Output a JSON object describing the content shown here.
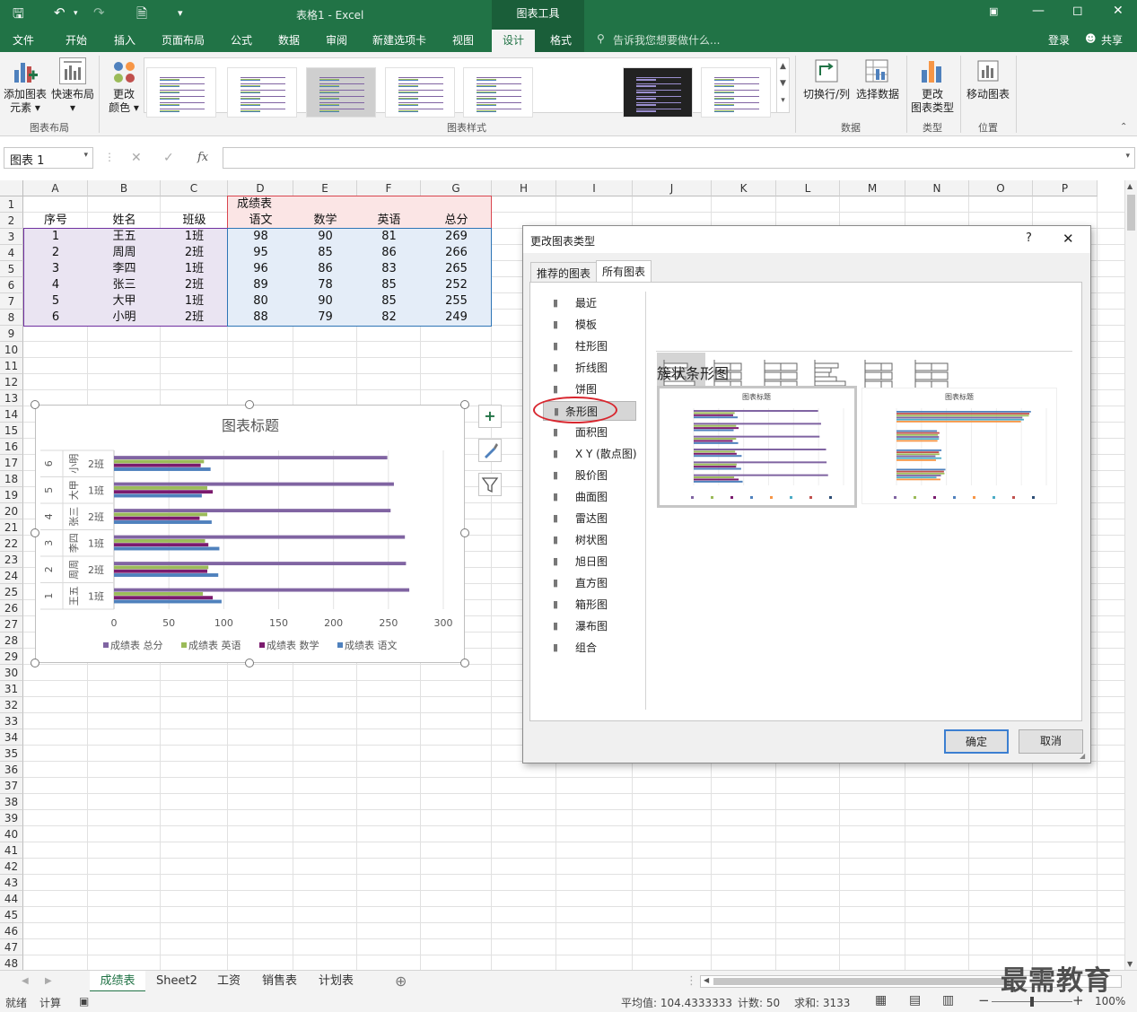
{
  "titlebar": {
    "title": "表格1 - Excel",
    "context_tools": "图表工具"
  },
  "tabs": [
    "文件",
    "开始",
    "插入",
    "页面布局",
    "公式",
    "数据",
    "审阅",
    "新建选项卡",
    "视图",
    "设计",
    "格式"
  ],
  "tell_me": "告诉我您想要做什么...",
  "login": "登录",
  "share": "共享",
  "ribbon": {
    "add_element": [
      "添加图表",
      "元素"
    ],
    "quick_layout": "快速布局",
    "change_color": [
      "更改",
      "颜色"
    ],
    "group_layout": "图表布局",
    "group_styles": "图表样式",
    "switch": "切换行/列",
    "select_data": "选择数据",
    "group_data": "数据",
    "change_type": [
      "更改",
      "图表类型"
    ],
    "group_type": "类型",
    "move_chart": "移动图表",
    "group_position": "位置"
  },
  "namebox": "图表 1",
  "fx": "fx",
  "columns": [
    "A",
    "B",
    "C",
    "D",
    "E",
    "F",
    "G",
    "H",
    "I",
    "J",
    "K",
    "L",
    "M",
    "N",
    "O",
    "P"
  ],
  "rows": [
    "1",
    "2",
    "3",
    "4",
    "5",
    "6",
    "7",
    "8",
    "9",
    "10",
    "11",
    "12",
    "13",
    "14",
    "15",
    "16",
    "17",
    "18",
    "19",
    "20",
    "21",
    "22",
    "23",
    "24",
    "25",
    "26",
    "27",
    "28",
    "29",
    "30",
    "31",
    "32",
    "33",
    "34",
    "35",
    "36",
    "37",
    "38",
    "39",
    "40",
    "41",
    "42",
    "43",
    "44",
    "45",
    "46",
    "47",
    "48"
  ],
  "table": {
    "merged_header": "成绩表",
    "headers": [
      "序号",
      "姓名",
      "班级",
      "语文",
      "数学",
      "英语",
      "总分"
    ],
    "rows": [
      [
        "1",
        "王五",
        "1班",
        "98",
        "90",
        "81",
        "269"
      ],
      [
        "2",
        "周周",
        "2班",
        "95",
        "85",
        "86",
        "266"
      ],
      [
        "3",
        "李四",
        "1班",
        "96",
        "86",
        "83",
        "265"
      ],
      [
        "4",
        "张三",
        "2班",
        "89",
        "78",
        "85",
        "252"
      ],
      [
        "5",
        "大甲",
        "1班",
        "80",
        "90",
        "85",
        "255"
      ],
      [
        "6",
        "小明",
        "2班",
        "88",
        "79",
        "82",
        "249"
      ]
    ]
  },
  "chart_data": {
    "type": "bar",
    "title": "图表标题",
    "categories": [
      {
        "num": "1",
        "name": "王五",
        "cls": "1班"
      },
      {
        "num": "2",
        "name": "周周",
        "cls": "2班"
      },
      {
        "num": "3",
        "name": "李四",
        "cls": "1班"
      },
      {
        "num": "4",
        "name": "张三",
        "cls": "2班"
      },
      {
        "num": "5",
        "name": "大甲",
        "cls": "1班"
      },
      {
        "num": "6",
        "name": "小明",
        "cls": "2班"
      }
    ],
    "series": [
      {
        "name": "成绩表 总分",
        "color": "#8064a2",
        "values": [
          269,
          266,
          265,
          252,
          255,
          249
        ]
      },
      {
        "name": "成绩表 英语",
        "color": "#9bbb59",
        "values": [
          81,
          86,
          83,
          85,
          85,
          82
        ]
      },
      {
        "name": "成绩表 数学",
        "color": "#7b1b6e",
        "values": [
          90,
          85,
          86,
          78,
          90,
          79
        ]
      },
      {
        "name": "成绩表 语文",
        "color": "#4f81bd",
        "values": [
          98,
          95,
          96,
          89,
          80,
          88
        ]
      }
    ],
    "xlim": [
      0,
      300
    ],
    "xticks": [
      "0",
      "50",
      "100",
      "150",
      "200",
      "250",
      "300"
    ],
    "legend": "bottom"
  },
  "dialog": {
    "title": "更改图表类型",
    "help": "?",
    "tab_recommended": "推荐的图表",
    "tab_all": "所有图表",
    "types": [
      {
        "label": "最近",
        "icon": "recent-icon"
      },
      {
        "label": "模板",
        "icon": "folder-icon"
      },
      {
        "label": "柱形图",
        "icon": "column-chart-icon"
      },
      {
        "label": "折线图",
        "icon": "line-chart-icon"
      },
      {
        "label": "饼图",
        "icon": "pie-chart-icon"
      },
      {
        "label": "条形图",
        "icon": "bar-chart-icon"
      },
      {
        "label": "面积图",
        "icon": "area-chart-icon"
      },
      {
        "label": "X Y (散点图)",
        "icon": "scatter-chart-icon"
      },
      {
        "label": "股价图",
        "icon": "stock-chart-icon"
      },
      {
        "label": "曲面图",
        "icon": "surface-chart-icon"
      },
      {
        "label": "雷达图",
        "icon": "radar-chart-icon"
      },
      {
        "label": "树状图",
        "icon": "treemap-icon"
      },
      {
        "label": "旭日图",
        "icon": "sunburst-icon"
      },
      {
        "label": "直方图",
        "icon": "histogram-icon"
      },
      {
        "label": "箱形图",
        "icon": "boxplot-icon"
      },
      {
        "label": "瀑布图",
        "icon": "waterfall-icon"
      },
      {
        "label": "组合",
        "icon": "combo-chart-icon"
      }
    ],
    "selected_type_index": 5,
    "subtype_title": "簇状条形图",
    "preview_title": "图表标题",
    "ok": "确定",
    "cancel": "取消"
  },
  "sheets": [
    "成绩表",
    "Sheet2",
    "工资",
    "销售表",
    "计划表"
  ],
  "status": {
    "ready": "就绪",
    "calc": "计算",
    "average": "平均值: 104.4333333",
    "count": "计数: 50",
    "sum": "求和: 3133",
    "zoom": "100%"
  },
  "watermark": "最需教育",
  "colors": {
    "excel_green": "#217346",
    "selected_red": "#c00000"
  }
}
